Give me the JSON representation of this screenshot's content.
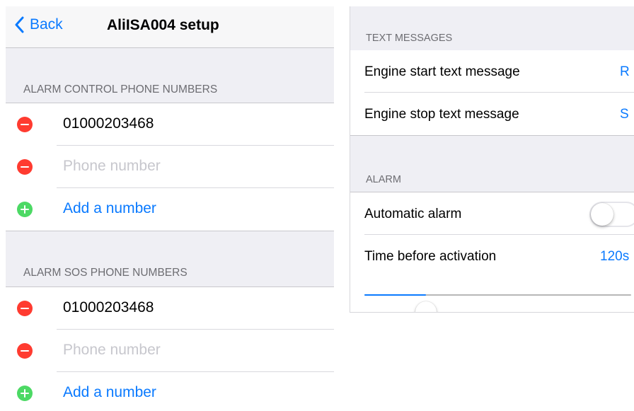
{
  "nav": {
    "back_label": "Back",
    "title": "AliISA004 setup"
  },
  "alarm_control": {
    "header": "ALARM CONTROL PHONE NUMBERS",
    "number": "01000203468",
    "placeholder": "Phone number",
    "add_label": "Add a number"
  },
  "alarm_sos": {
    "header": "ALARM SOS PHONE NUMBERS",
    "number": "01000203468",
    "placeholder": "Phone number",
    "add_label": "Add a number"
  },
  "text_messages": {
    "header": "TEXT MESSAGES",
    "start_label": "Engine start text message",
    "start_value": "R",
    "stop_label": "Engine stop text message",
    "stop_value": "S"
  },
  "alarm": {
    "header": "ALARM",
    "auto_label": "Automatic alarm",
    "auto_enabled": false,
    "time_label": "Time before activation",
    "time_value": "120s",
    "slider_level": 0.23
  },
  "colors": {
    "accent": "#0a7aff",
    "delete": "#ff3b30",
    "add": "#4cd964",
    "background": "#efeff4"
  },
  "icons": {
    "back": "chevron-left-icon",
    "delete": "minus-circle-icon",
    "add": "plus-circle-icon"
  }
}
